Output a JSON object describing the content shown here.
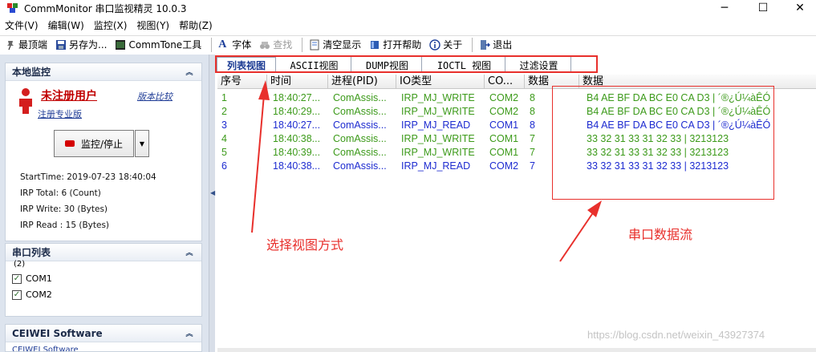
{
  "window": {
    "title": "CommMonitor 串口监视精灵 10.0.3",
    "minimize": "─",
    "maximize": "☐",
    "close": "✕"
  },
  "menu": [
    "文件(V)",
    "编辑(W)",
    "监控(X)",
    "视图(Y)",
    "帮助(Z)"
  ],
  "toolbar": {
    "topmost": "最顶端",
    "save_as": "另存为...",
    "commtone": "CommTone工具",
    "font": "字体",
    "find": "查找",
    "clear": "清空显示",
    "open_help": "打开帮助",
    "about": "关于",
    "exit": "退出"
  },
  "local_monitor": {
    "header": "本地监控",
    "user_name": "未注册用户",
    "version_compare": "版本比较",
    "register": "注册专业版",
    "monitor_button": "监控/停止",
    "stats": [
      "StartTime: 2019-07-23 18:40:04",
      "IRP Total: 6 (Count)",
      "IRP Write: 30 (Bytes)",
      "IRP Read : 15 (Bytes)"
    ]
  },
  "port_list": {
    "header": "串口列表",
    "count": "(2)",
    "ports": [
      {
        "label": "COM1",
        "checked": true
      },
      {
        "label": "COM2",
        "checked": true
      }
    ]
  },
  "ceiwei": {
    "header": "CEIWEI Software",
    "item": "CEIWEI Software"
  },
  "tabs": [
    "列表视图",
    "ASCII视图",
    "DUMP视图",
    "IOCTL 视图",
    "过滤设置"
  ],
  "active_tab": 0,
  "table": {
    "columns": [
      "序号",
      "时间",
      "进程(PID)",
      "IO类型",
      "CO...",
      "数据",
      "数据"
    ],
    "rows": [
      {
        "no": "1",
        "time": "18:40:27...",
        "process": "ComAssis...",
        "io": "IRP_MJ_WRITE",
        "port": "COM2",
        "len": "8",
        "data": "B4 AE BF DA BC E0 CA D3  | ´®¿Ú¼àÊÓ",
        "type": "write"
      },
      {
        "no": "2",
        "time": "18:40:29...",
        "process": "ComAssis...",
        "io": "IRP_MJ_WRITE",
        "port": "COM2",
        "len": "8",
        "data": "B4 AE BF DA BC E0 CA D3  | ´®¿Ú¼àÊÓ",
        "type": "write"
      },
      {
        "no": "3",
        "time": "18:40:27...",
        "process": "ComAssis...",
        "io": "IRP_MJ_READ",
        "port": "COM1",
        "len": "8",
        "data": "B4 AE BF DA BC E0 CA D3  | ´®¿Ú¼àÊÓ",
        "type": "read"
      },
      {
        "no": "4",
        "time": "18:40:38...",
        "process": "ComAssis...",
        "io": "IRP_MJ_WRITE",
        "port": "COM1",
        "len": "7",
        "data": "33 32 31 33 31 32 33  | 3213123",
        "type": "write"
      },
      {
        "no": "5",
        "time": "18:40:39...",
        "process": "ComAssis...",
        "io": "IRP_MJ_WRITE",
        "port": "COM1",
        "len": "7",
        "data": "33 32 31 33 31 32 33  | 3213123",
        "type": "write"
      },
      {
        "no": "6",
        "time": "18:40:38...",
        "process": "ComAssis...",
        "io": "IRP_MJ_READ",
        "port": "COM2",
        "len": "7",
        "data": "33 32 31 33 31 32 33  | 3213123",
        "type": "read"
      }
    ]
  },
  "annotations": {
    "select_view": "选择视图方式",
    "data_stream": "串口数据流"
  },
  "watermark": "https://blog.csdn.net/weixin_43927374",
  "colors": {
    "write": "#3c9a1a",
    "read": "#1d2bd0",
    "annotation": "#e8302c",
    "link": "#1f3c96"
  }
}
